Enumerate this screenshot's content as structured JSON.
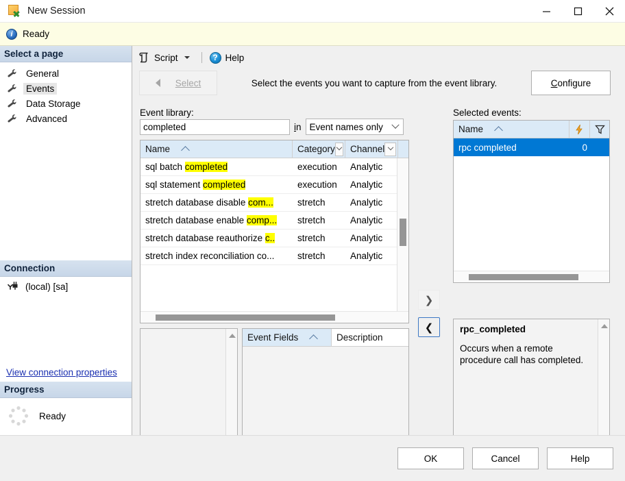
{
  "window": {
    "title": "New Session",
    "icon": "session-icon",
    "minimize": "—",
    "maximize": "□",
    "close": "✕"
  },
  "infobar": {
    "icon": "info-icon",
    "text": "Ready"
  },
  "sidebar": {
    "header": "Select a page",
    "items": [
      {
        "label": "General",
        "icon": "wrench-icon",
        "selected": false
      },
      {
        "label": "Events",
        "icon": "wrench-icon",
        "selected": true
      },
      {
        "label": "Data Storage",
        "icon": "wrench-icon",
        "selected": false
      },
      {
        "label": "Advanced",
        "icon": "wrench-icon",
        "selected": false
      }
    ],
    "connection": {
      "header": "Connection",
      "server": "(local) [sa]",
      "icon": "plug-icon",
      "link": "View connection properties"
    },
    "progress": {
      "header": "Progress",
      "status": "Ready",
      "icon": "spinner-icon"
    }
  },
  "toolbar": {
    "script_label": "Script",
    "script_icon": "script-icon",
    "dropdown_icon": "caret-down-icon",
    "help_label": "Help",
    "help_icon": "help-icon"
  },
  "navstrip": {
    "back_label": "Select",
    "back_icon": "triangle-left-icon",
    "caption": "Select the events you want to capture from the event library.",
    "configure_label": "Configure",
    "configure_icon": "triangle-right-icon"
  },
  "event_library": {
    "label": "Event library:",
    "search_value": "completed",
    "search_placeholder": "",
    "in_word": "in",
    "scope_value": "Event names only",
    "columns": [
      "Name",
      "Category",
      "Channel"
    ],
    "sort_column": "Name",
    "sort_direction": "ascending",
    "rows": [
      {
        "name_prefix": "sql  batch  ",
        "name_match": "completed",
        "name_suffix": "",
        "category": "execution",
        "channel": "Analytic"
      },
      {
        "name_prefix": "sql  statement  ",
        "name_match": "completed",
        "name_suffix": "",
        "category": "execution",
        "channel": "Analytic"
      },
      {
        "name_prefix": "stretch  database  disable  ",
        "name_match": "com...",
        "name_suffix": "",
        "category": "stretch",
        "channel": "Analytic"
      },
      {
        "name_prefix": "stretch  database  enable  ",
        "name_match": "comp...",
        "name_suffix": "",
        "category": "stretch",
        "channel": "Analytic"
      },
      {
        "name_prefix": "stretch  database  reauthorize  ",
        "name_match": "c..",
        "name_suffix": "",
        "category": "stretch",
        "channel": "Analytic"
      },
      {
        "name_prefix": "stretch  index  reconciliation  co...",
        "name_match": "",
        "name_suffix": "",
        "category": "stretch",
        "channel": "Analytic"
      }
    ]
  },
  "transfer": {
    "add_icon": "chevron-right-icon",
    "remove_icon": "chevron-left-icon"
  },
  "selected_events": {
    "label": "Selected events:",
    "columns": [
      "Name",
      "",
      ""
    ],
    "column_icons": [
      "",
      "lightning-icon",
      "filter-icon"
    ],
    "sort_column": "Name",
    "rows": [
      {
        "name": "rpc  completed",
        "count": "0",
        "selected": true
      }
    ]
  },
  "event_fields": {
    "columns": [
      "Event Fields",
      "Description"
    ],
    "rows": []
  },
  "description": {
    "title": "rpc_completed",
    "body": "Occurs when a remote procedure call has completed."
  },
  "footer": {
    "ok": "OK",
    "cancel": "Cancel",
    "help": "Help"
  }
}
